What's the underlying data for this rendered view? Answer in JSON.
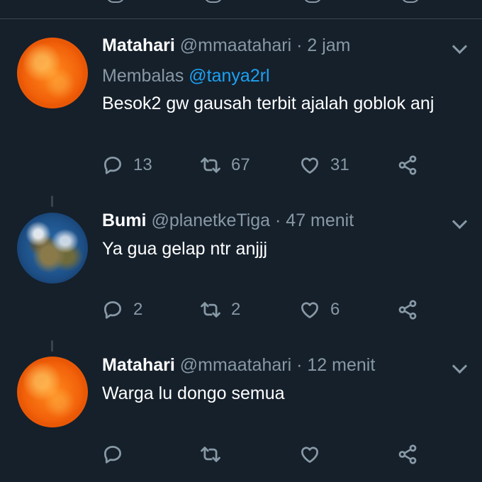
{
  "tweets": [
    {
      "name": "Matahari",
      "handle": "@mmaatahari",
      "sep": "·",
      "time": "2 jam",
      "reply_prefix": "Membalas",
      "reply_mention": "@tanya2rl",
      "text": "Besok2 gw gausah terbit ajalah goblok anj",
      "replies": "13",
      "retweets": "67",
      "likes": "31",
      "avatar_icon": "sun-avatar"
    },
    {
      "name": "Bumi",
      "handle": "@planetkeTiga",
      "sep": "·",
      "time": "47 menit",
      "text": "Ya gua gelap ntr anjjj",
      "replies": "2",
      "retweets": "2",
      "likes": "6",
      "avatar_icon": "earth-avatar"
    },
    {
      "name": "Matahari",
      "handle": "@mmaatahari",
      "sep": "·",
      "time": "12 menit",
      "text": "Warga lu dongo semua",
      "replies": "",
      "retweets": "",
      "likes": "",
      "avatar_icon": "sun-avatar"
    }
  ],
  "colors": {
    "background": "#15202b",
    "secondary_text": "#8899a6",
    "link": "#1da1f2",
    "divider": "#38444d"
  }
}
